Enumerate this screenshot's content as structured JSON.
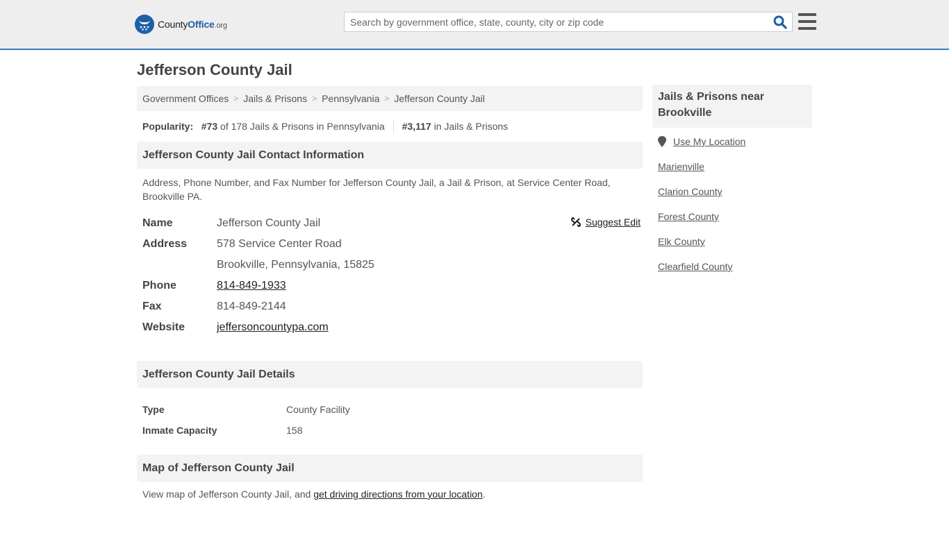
{
  "header": {
    "logo": {
      "text_main": "County",
      "text_accent": "Office",
      "text_suffix": ".org"
    },
    "search": {
      "placeholder": "Search by government office, state, county, city or zip code",
      "value": ""
    },
    "icons": {
      "search": "search-icon",
      "menu": "hamburger-menu-icon"
    },
    "colors": {
      "brand": "#1f5fa6",
      "header_border": "#3979c0"
    }
  },
  "page": {
    "title": "Jefferson County Jail"
  },
  "breadcrumb": [
    {
      "label": "Government Offices"
    },
    {
      "label": "Jails & Prisons"
    },
    {
      "label": "Pennsylvania"
    },
    {
      "label": "Jefferson County Jail"
    }
  ],
  "breadcrumb_separator": ">",
  "popularity": {
    "label": "Popularity:",
    "state_rank": "#73",
    "state_rank_text": "of 178 Jails & Prisons in Pennsylvania",
    "overall_rank": "#3,117",
    "overall_rank_text": "in Jails & Prisons"
  },
  "contact": {
    "heading": "Jefferson County Jail Contact Information",
    "description": "Address, Phone Number, and Fax Number for Jefferson County Jail, a Jail & Prison, at Service Center Road, Brookville PA.",
    "suggest_edit": "Suggest Edit",
    "rows": {
      "name_label": "Name",
      "name_value": "Jefferson County Jail",
      "address_label": "Address",
      "address_line1": "578 Service Center Road",
      "address_line2": "Brookville, Pennsylvania, 15825",
      "phone_label": "Phone",
      "phone_value": "814-849-1933",
      "fax_label": "Fax",
      "fax_value": "814-849-2144",
      "website_label": "Website",
      "website_value": "jeffersoncountypa.com"
    }
  },
  "details": {
    "heading": "Jefferson County Jail Details",
    "type_label": "Type",
    "type_value": "County Facility",
    "capacity_label": "Inmate Capacity",
    "capacity_value": "158"
  },
  "map": {
    "heading": "Map of Jefferson County Jail",
    "text_before": "View map of Jefferson County Jail, and ",
    "link": "get driving directions from your location",
    "text_after": "."
  },
  "sidebar": {
    "heading": "Jails & Prisons near Brookville",
    "use_location": "Use My Location",
    "items": [
      {
        "label": "Marienville"
      },
      {
        "label": "Clarion County"
      },
      {
        "label": "Forest County"
      },
      {
        "label": "Elk County"
      },
      {
        "label": "Clearfield County"
      }
    ]
  }
}
